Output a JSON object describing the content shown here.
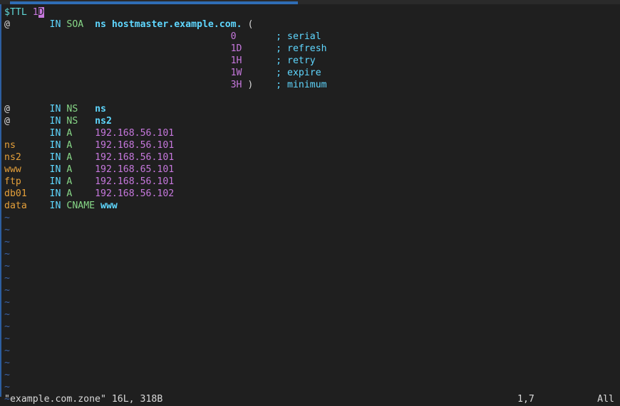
{
  "colors": {
    "background": "#1f1f1f",
    "text": "#d8d8d8",
    "ttl_keyword": "#5fd7d7",
    "numbers": "#c678dd",
    "owner_names": "#e5a03a",
    "class_keyword": "#5fd7ff",
    "record_type": "#87d787",
    "hostnames": "#5fd7ff",
    "empty_line_marker": "#3a63a8",
    "scrollbar": "#2f6db5"
  },
  "editor": {
    "lines": [
      [
        {
          "t": "$TTL ",
          "c": "c-var"
        },
        {
          "t": "1",
          "c": "c-num"
        },
        {
          "t": "D",
          "c": "cursor"
        }
      ],
      [
        {
          "t": "@",
          "c": ""
        },
        {
          "t": "       ",
          "c": ""
        },
        {
          "t": "IN",
          "c": "c-kw"
        },
        {
          "t": " ",
          "c": ""
        },
        {
          "t": "SOA",
          "c": "c-type"
        },
        {
          "t": "  ",
          "c": ""
        },
        {
          "t": "ns hostmaster.example.com.",
          "c": "c-host"
        },
        {
          "t": " (",
          "c": "c-paren"
        }
      ],
      [
        {
          "t": "                                        ",
          "c": ""
        },
        {
          "t": "0",
          "c": "c-num"
        },
        {
          "t": "       ",
          "c": ""
        },
        {
          "t": "; serial",
          "c": "c-cmt"
        }
      ],
      [
        {
          "t": "                                        ",
          "c": ""
        },
        {
          "t": "1D",
          "c": "c-num"
        },
        {
          "t": "      ",
          "c": ""
        },
        {
          "t": "; refresh",
          "c": "c-cmt"
        }
      ],
      [
        {
          "t": "                                        ",
          "c": ""
        },
        {
          "t": "1H",
          "c": "c-num"
        },
        {
          "t": "      ",
          "c": ""
        },
        {
          "t": "; retry",
          "c": "c-cmt"
        }
      ],
      [
        {
          "t": "                                        ",
          "c": ""
        },
        {
          "t": "1W",
          "c": "c-num"
        },
        {
          "t": "      ",
          "c": ""
        },
        {
          "t": "; expire",
          "c": "c-cmt"
        }
      ],
      [
        {
          "t": "                                        ",
          "c": ""
        },
        {
          "t": "3H",
          "c": "c-num"
        },
        {
          "t": " )",
          "c": "c-paren"
        },
        {
          "t": "    ",
          "c": ""
        },
        {
          "t": "; minimum",
          "c": "c-cmt"
        }
      ],
      [
        {
          "t": "",
          "c": ""
        }
      ],
      [
        {
          "t": "@",
          "c": ""
        },
        {
          "t": "       ",
          "c": ""
        },
        {
          "t": "IN",
          "c": "c-kw"
        },
        {
          "t": " ",
          "c": ""
        },
        {
          "t": "NS",
          "c": "c-type"
        },
        {
          "t": "   ",
          "c": ""
        },
        {
          "t": "ns",
          "c": "c-host"
        }
      ],
      [
        {
          "t": "@",
          "c": ""
        },
        {
          "t": "       ",
          "c": ""
        },
        {
          "t": "IN",
          "c": "c-kw"
        },
        {
          "t": " ",
          "c": ""
        },
        {
          "t": "NS",
          "c": "c-type"
        },
        {
          "t": "   ",
          "c": ""
        },
        {
          "t": "ns2",
          "c": "c-host"
        }
      ],
      [
        {
          "t": "        ",
          "c": ""
        },
        {
          "t": "IN",
          "c": "c-kw"
        },
        {
          "t": " ",
          "c": ""
        },
        {
          "t": "A",
          "c": "c-type"
        },
        {
          "t": "    ",
          "c": ""
        },
        {
          "t": "192.168.56.101",
          "c": "c-num"
        }
      ],
      [
        {
          "t": "ns",
          "c": "c-yel"
        },
        {
          "t": "      ",
          "c": ""
        },
        {
          "t": "IN",
          "c": "c-kw"
        },
        {
          "t": " ",
          "c": ""
        },
        {
          "t": "A",
          "c": "c-type"
        },
        {
          "t": "    ",
          "c": ""
        },
        {
          "t": "192.168.56.101",
          "c": "c-num"
        }
      ],
      [
        {
          "t": "ns2",
          "c": "c-yel"
        },
        {
          "t": "     ",
          "c": ""
        },
        {
          "t": "IN",
          "c": "c-kw"
        },
        {
          "t": " ",
          "c": ""
        },
        {
          "t": "A",
          "c": "c-type"
        },
        {
          "t": "    ",
          "c": ""
        },
        {
          "t": "192.168.56.101",
          "c": "c-num"
        }
      ],
      [
        {
          "t": "www",
          "c": "c-yel"
        },
        {
          "t": "     ",
          "c": ""
        },
        {
          "t": "IN",
          "c": "c-kw"
        },
        {
          "t": " ",
          "c": ""
        },
        {
          "t": "A",
          "c": "c-type"
        },
        {
          "t": "    ",
          "c": ""
        },
        {
          "t": "192.168.65.101",
          "c": "c-num"
        }
      ],
      [
        {
          "t": "ftp",
          "c": "c-yel"
        },
        {
          "t": "     ",
          "c": ""
        },
        {
          "t": "IN",
          "c": "c-kw"
        },
        {
          "t": " ",
          "c": ""
        },
        {
          "t": "A",
          "c": "c-type"
        },
        {
          "t": "    ",
          "c": ""
        },
        {
          "t": "192.168.56.101",
          "c": "c-num"
        }
      ],
      [
        {
          "t": "db01",
          "c": "c-yel"
        },
        {
          "t": "    ",
          "c": ""
        },
        {
          "t": "IN",
          "c": "c-kw"
        },
        {
          "t": " ",
          "c": ""
        },
        {
          "t": "A",
          "c": "c-type"
        },
        {
          "t": "    ",
          "c": ""
        },
        {
          "t": "192.168.56.102",
          "c": "c-num"
        }
      ],
      [
        {
          "t": "data",
          "c": "c-yel"
        },
        {
          "t": "    ",
          "c": ""
        },
        {
          "t": "IN",
          "c": "c-kw"
        },
        {
          "t": " ",
          "c": ""
        },
        {
          "t": "CNAME",
          "c": "c-type"
        },
        {
          "t": " ",
          "c": ""
        },
        {
          "t": "www",
          "c": "c-host"
        }
      ]
    ],
    "empty_line_marker": "~",
    "empty_line_count": 16
  },
  "statusline": {
    "file_info": "\"example.com.zone\" 16L, 318B",
    "cursor_position": "1,7",
    "scroll_position": "All"
  }
}
